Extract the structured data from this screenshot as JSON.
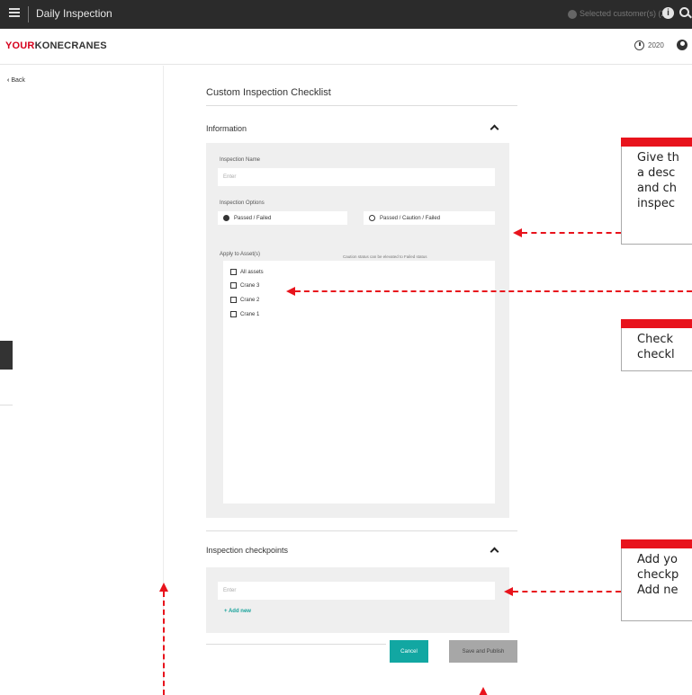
{
  "topbar": {
    "app_title": "Daily Inspection",
    "customer_text": "Selected customer(s) (2)",
    "info_glyph": "i"
  },
  "brand": {
    "logo_your": "YOUR",
    "logo_rest": "KONECRANES",
    "year": "2020"
  },
  "nav": {
    "back_label": "Back",
    "back_glyph": "‹"
  },
  "page": {
    "title": "Custom Inspection Checklist",
    "information": {
      "header": "Information",
      "name_label": "Inspection Name",
      "name_placeholder": "Enter",
      "options_label": "Inspection Options",
      "option_passed_failed": "Passed / Failed",
      "option_passed_caution_failed": "Passed / Caution / Failed",
      "caution_hint": "Caution status can be elevated to Failed status",
      "assets_label": "Apply to Asset(s)",
      "assets": [
        "All assets",
        "Crane 3",
        "Crane 2",
        "Crane 1"
      ]
    },
    "checkpoints": {
      "header": "Inspection checkpoints",
      "placeholder": "Enter",
      "add_new": "+ Add new"
    },
    "buttons": {
      "cancel": "Cancel",
      "publish": "Save and Publish"
    }
  },
  "callouts": [
    {
      "lines": [
        "Give th",
        "a desc",
        "and ch",
        "inspec"
      ]
    },
    {
      "lines": [
        "Check",
        "checkl"
      ]
    },
    {
      "lines": [
        "Add yo",
        "checkp",
        "Add ne"
      ]
    }
  ],
  "colors": {
    "accent_red": "#e8131c",
    "brand_red": "#d6001c",
    "teal": "#12a7a2",
    "topbar": "#2b2b2b",
    "panel": "#efefef"
  }
}
